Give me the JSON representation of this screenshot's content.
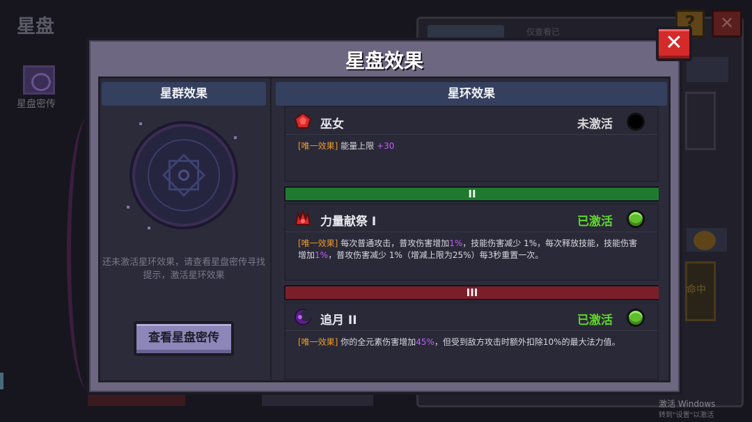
{
  "background": {
    "screen_title": "星盘",
    "side_item_label": "星盘密传",
    "tab_label": "",
    "only_seen_label": "仅查看已",
    "help_glyph": "?",
    "close_glyph": "✕",
    "card_text": "命中"
  },
  "modal": {
    "title": "星盘效果",
    "close_glyph": "✕",
    "left": {
      "header": "星群效果",
      "hint": "还未激活星环效果，请查看星盘密传寻找提示，激活星环效果",
      "button": "查看星盘密传"
    },
    "right": {
      "header": "星环效果",
      "effects": [
        {
          "name": "巫女",
          "status": "未激活",
          "status_color": "#d8d8d8",
          "dot_color": "#000000",
          "icon": "red-gem-icon",
          "desc_tag": "[唯一效果]",
          "desc_parts": [
            "能量上限 ",
            "+30",
            ""
          ]
        },
        {
          "name": "力量献祭 I",
          "status": "已激活",
          "status_color": "#5fd82a",
          "dot_color": "#5fbf2a",
          "icon": "red-claw-icon",
          "desc_tag": "[唯一效果]",
          "desc_parts": [
            "每次普通攻击，普攻伤害增加",
            "1%",
            "，技能伤害减少 1%，每次释放技能，技能伤害增加",
            "1%",
            "，普攻伤害减少 1%（增减上限为25%）每3秒重置一次。"
          ]
        },
        {
          "name": "追月 II",
          "status": "已激活",
          "status_color": "#5fd82a",
          "dot_color": "#5fbf2a",
          "icon": "purple-moon-icon",
          "desc_tag": "[唯一效果]",
          "desc_parts": [
            "你的全元素伤害增加",
            "45%",
            "，但受到敌方攻击时额外扣除10%的最大法力值。"
          ]
        }
      ],
      "tiers": [
        {
          "label": "II",
          "color": "#1f7a2e"
        },
        {
          "label": "III",
          "color": "#7a1f2a"
        }
      ]
    }
  },
  "watermark": {
    "line1": "激活 Windows",
    "line2": "转到\"设置\"以激活 Windows。"
  }
}
